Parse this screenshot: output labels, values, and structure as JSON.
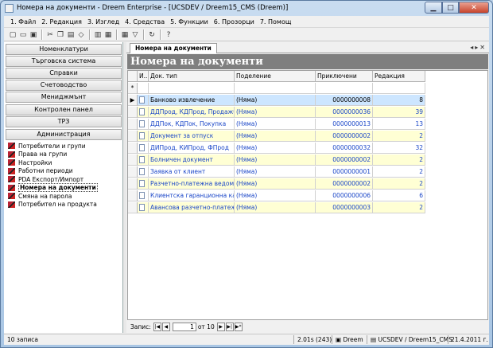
{
  "window": {
    "title": "Номера на документи - Dreem Enterprise - [UCSDEV / Dreem15_CMS (Dreem)]"
  },
  "menu": [
    "1. Файл",
    "2. Редакция",
    "3. Изглед",
    "4. Средства",
    "5. Функции",
    "6. Прозорци",
    "7. Помощ"
  ],
  "nav": {
    "sections": [
      "Номенклатури",
      "Търговска система",
      "Справки",
      "Счетоводство",
      "Мениджмънт",
      "Контролен панел",
      "ТРЗ",
      "Администрация"
    ],
    "tree": [
      {
        "label": "Потребители и групи",
        "selected": false
      },
      {
        "label": "Права на групи",
        "selected": false
      },
      {
        "label": "Настройки",
        "selected": false
      },
      {
        "label": "Работни периоди",
        "selected": false
      },
      {
        "label": "PDA Експорт/Импорт",
        "selected": false
      },
      {
        "label": "Номера на документи",
        "selected": true
      },
      {
        "label": "Смяна на парола",
        "selected": false
      },
      {
        "label": "Потребител на продукта",
        "selected": false
      }
    ]
  },
  "main": {
    "tab_label": "Номера на документи",
    "heading": "Номера на документи",
    "columns": {
      "icon": "И...",
      "doc_type": "Док. тип",
      "subdivision": "Поделение",
      "attachments": "Приключени",
      "version": "Редакция"
    },
    "new_row_marker": "*",
    "current_marker": "▶",
    "rows": [
      {
        "doc_type": "Банково извлечение",
        "subdivision": "(Няма)",
        "attachments": "0000000008",
        "version": "8"
      },
      {
        "doc_type": "ДДПрод, КДПрод, Продажба",
        "subdivision": "(Няма)",
        "attachments": "0000000036",
        "version": "39"
      },
      {
        "doc_type": "ДДПок, КДПок, Покупка",
        "subdivision": "(Няма)",
        "attachments": "0000000013",
        "version": "13"
      },
      {
        "doc_type": "Документ за отпуск",
        "subdivision": "(Няма)",
        "attachments": "0000000002",
        "version": "2"
      },
      {
        "doc_type": "ДИПрод, КИПрод, ФПрод",
        "subdivision": "(Няма)",
        "attachments": "0000000032",
        "version": "32"
      },
      {
        "doc_type": "Болничен документ",
        "subdivision": "(Няма)",
        "attachments": "0000000002",
        "version": "2"
      },
      {
        "doc_type": "Заявка от клиент",
        "subdivision": "(Няма)",
        "attachments": "0000000001",
        "version": "2"
      },
      {
        "doc_type": "Разчетно-платежна ведомо...",
        "subdivision": "(Няма)",
        "attachments": "0000000002",
        "version": "2"
      },
      {
        "doc_type": "Клиентска гаранционна ка...",
        "subdivision": "(Няма)",
        "attachments": "0000000006",
        "version": "6"
      },
      {
        "doc_type": "Авансова разчетно-платеж...",
        "subdivision": "(Няма)",
        "attachments": "0000000003",
        "version": "2"
      }
    ],
    "record_nav": {
      "label": "Запис:",
      "current": "1",
      "of_text": "от 10"
    }
  },
  "status": {
    "records": "10 записа",
    "timing": "2.01s (243)",
    "app": "Dreem",
    "db": "UCSDEV / Dreem15_CMS",
    "date": "21.4.2011 г."
  }
}
